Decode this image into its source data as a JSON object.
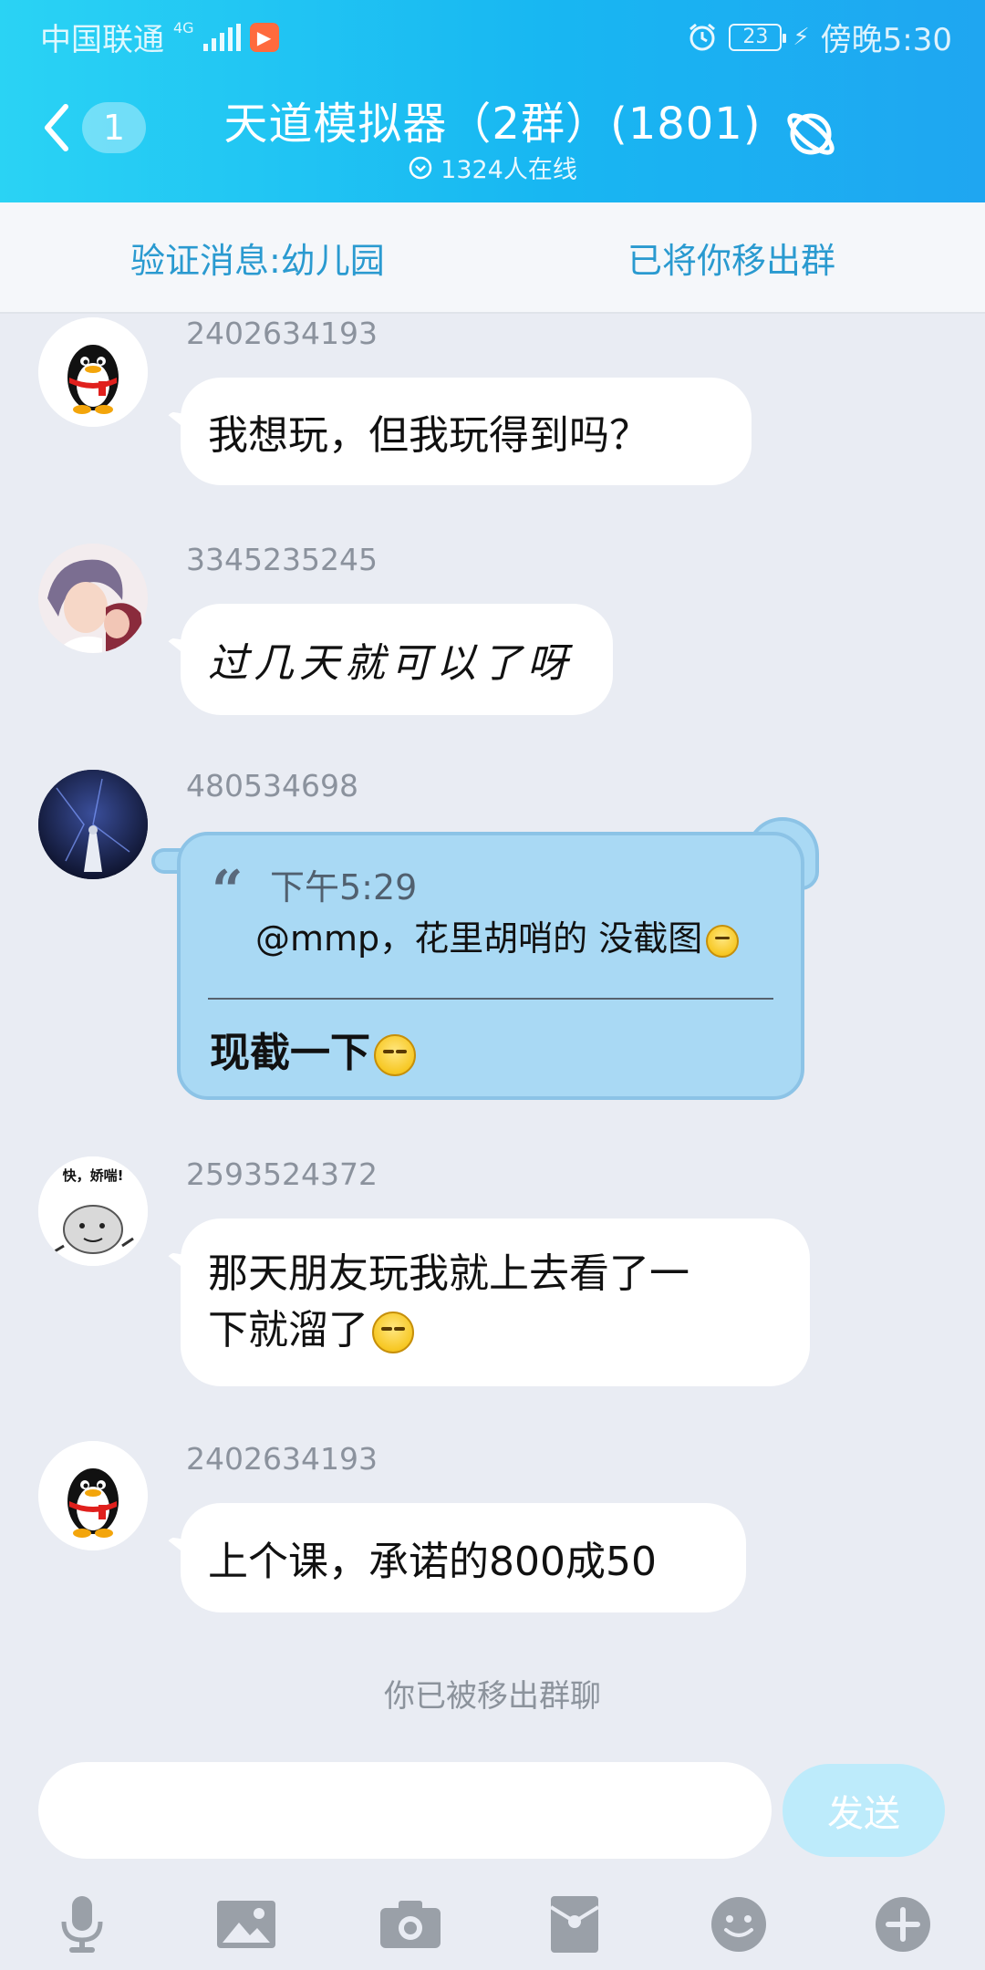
{
  "status": {
    "carrier": "中国联通",
    "network": "4G",
    "battery": "23",
    "time": "傍晚5:30"
  },
  "header": {
    "unread_count": "1",
    "title": "天道模拟器（2群）(1801)",
    "online": "1324人在线"
  },
  "notice": {
    "left": "验证消息:幼儿园",
    "right": "已将你移出群"
  },
  "messages": [
    {
      "uid": "2402634193",
      "text": "我想玩，但我玩得到吗？"
    },
    {
      "uid": "3345235245",
      "text": "过几天就可以了呀"
    },
    {
      "uid": "480534698",
      "quote_time": "下午5:29",
      "quote_text": "@mmp，花里胡哨的 没截图",
      "text": "现截一下"
    },
    {
      "uid": "2593524372",
      "text_line1": "那天朋友玩我就上去看了一",
      "text_line2": "下就溜了",
      "sticker_text": "快，娇喘!"
    },
    {
      "uid": "2402634193",
      "text": "上个课，承诺的800成50"
    }
  ],
  "system_note": "你已被移出群聊",
  "input": {
    "placeholder": "",
    "send_label": "发送"
  },
  "toolbar": [
    "mic-icon",
    "image-icon",
    "camera-icon",
    "red-packet-icon",
    "emoji-icon",
    "plus-icon"
  ],
  "colors": {
    "header_start": "#2ad3f4",
    "header_end": "#1fa6f1",
    "notice_text": "#2a9ad0",
    "send_disabled": "#bdebfb"
  }
}
